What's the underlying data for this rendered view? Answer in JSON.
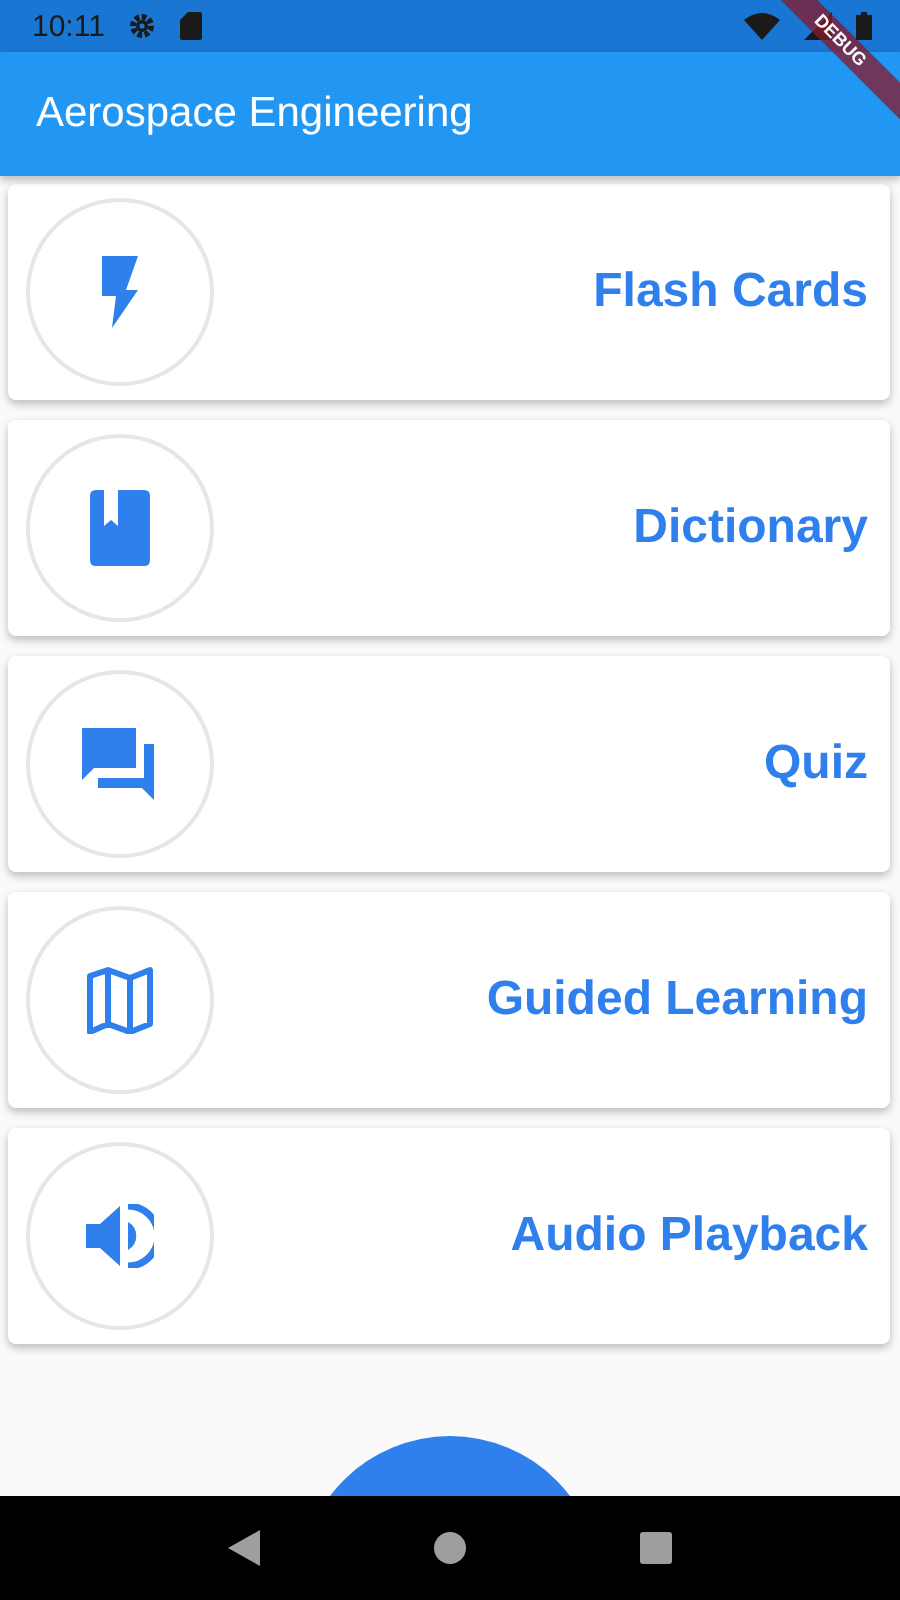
{
  "status_bar": {
    "time": "10:11"
  },
  "app_bar": {
    "title": "Aerospace Engineering"
  },
  "debug_banner": {
    "label": "DEBUG"
  },
  "menu": [
    {
      "label": "Flash Cards",
      "kind": "bolt"
    },
    {
      "label": "Dictionary",
      "kind": "book"
    },
    {
      "label": "Quiz",
      "kind": "chat"
    },
    {
      "label": "Guided Learning",
      "kind": "map"
    },
    {
      "label": "Audio Playback",
      "kind": "speaker"
    }
  ]
}
